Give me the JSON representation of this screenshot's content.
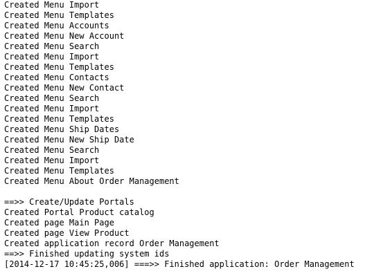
{
  "console": {
    "lines": [
      "Created Menu Import",
      "Created Menu Templates",
      "Created Menu Accounts",
      "Created Menu New Account",
      "Created Menu Search",
      "Created Menu Import",
      "Created Menu Templates",
      "Created Menu Contacts",
      "Created Menu New Contact",
      "Created Menu Search",
      "Created Menu Import",
      "Created Menu Templates",
      "Created Menu Ship Dates",
      "Created Menu New Ship Date",
      "Created Menu Search",
      "Created Menu Import",
      "Created Menu Templates",
      "Created Menu About Order Management",
      "",
      "==>> Create/Update Portals",
      "Created Portal Product catalog",
      "Created page Main Page",
      "Created page View Product",
      "Created application record Order Management",
      "==>> Finished updating system ids",
      "[2014-12-17 10:45:25,006] ===>> Finished application: Order Management"
    ]
  }
}
